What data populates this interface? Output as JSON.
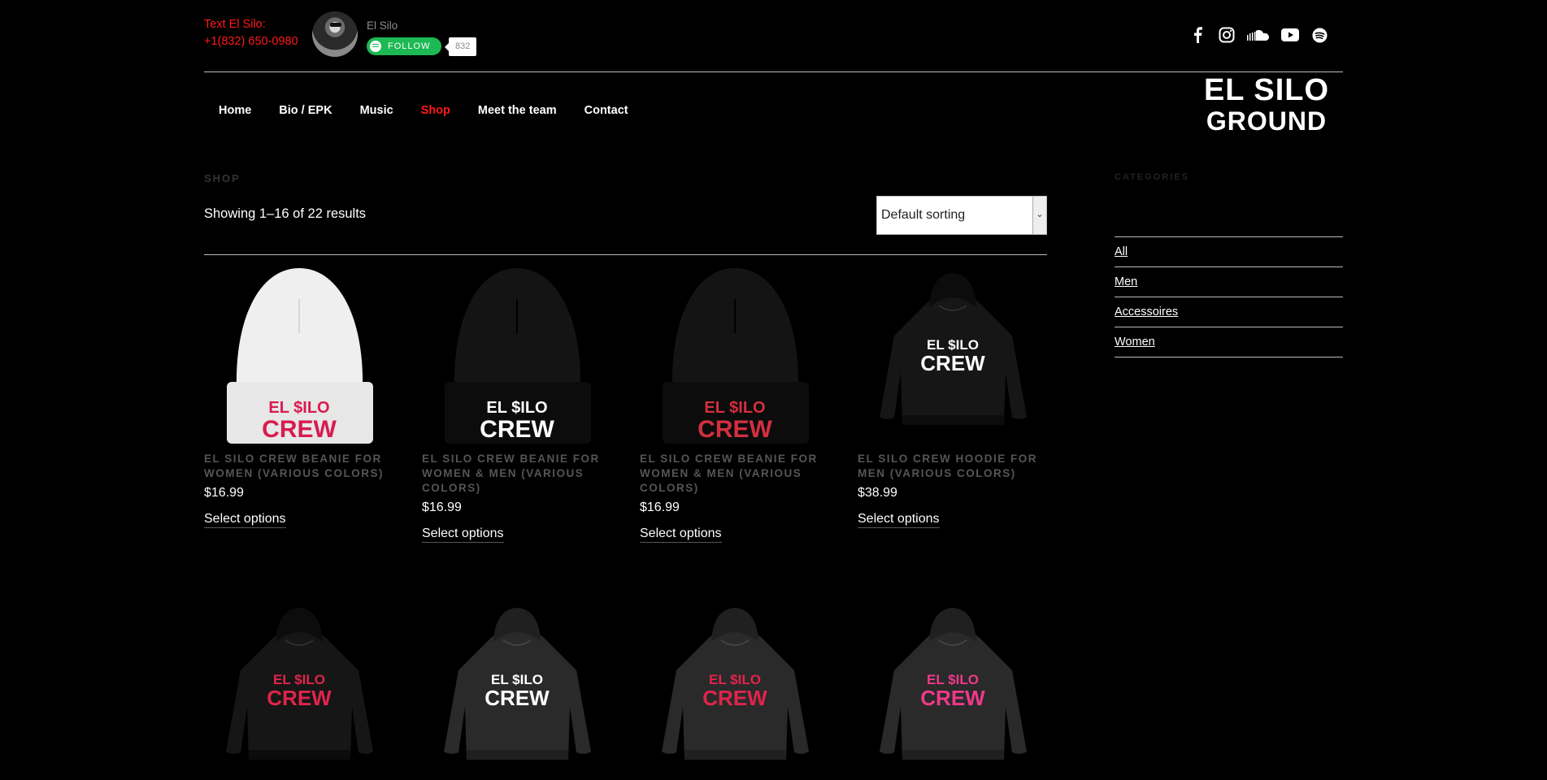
{
  "header": {
    "text_label": "Text El Silo:",
    "phone": "+1(832) 650-0980",
    "artist_name": "El Silo",
    "follow_label": "FOLLOW",
    "follower_count": "832",
    "social_icons": [
      "facebook-icon",
      "instagram-icon",
      "soundcloud-icon",
      "youtube-icon",
      "spotify-icon"
    ]
  },
  "nav": {
    "items": [
      "Home",
      "Bio / EPK",
      "Music",
      "Shop",
      "Meet the team",
      "Contact"
    ],
    "active": "Shop"
  },
  "logo": {
    "line1": "EL SILO",
    "line2": "GROUND"
  },
  "main": {
    "title": "SHOP",
    "result_count": "Showing 1–16 of 22 results",
    "sort_selected": "Default sorting"
  },
  "products": [
    {
      "title": "EL SILO CREW BEANIE FOR WOMEN (VARIOUS COLORS)",
      "price": "$16.99",
      "action": "Select options",
      "thumb": {
        "kind": "beanie",
        "color": "#efefef",
        "logo_color": "#d81b4f",
        "logo": [
          "EL $ILO",
          "CREW"
        ]
      }
    },
    {
      "title": "EL SILO CREW BEANIE FOR WOMEN & MEN (VARIOUS COLORS)",
      "price": "$16.99",
      "action": "Select options",
      "thumb": {
        "kind": "beanie",
        "color": "#141414",
        "logo_color": "#ffffff",
        "logo": [
          "EL $ILO",
          "CREW"
        ]
      }
    },
    {
      "title": "EL SILO CREW BEANIE FOR WOMEN & MEN (VARIOUS COLORS)",
      "price": "$16.99",
      "action": "Select options",
      "thumb": {
        "kind": "beanie",
        "color": "#141414",
        "logo_color": "#d32f3f",
        "logo": [
          "EL $ILO",
          "CREW"
        ]
      }
    },
    {
      "title": "EL SILO CREW HOODIE FOR MEN (VARIOUS COLORS)",
      "price": "$38.99",
      "action": "Select options",
      "thumb": {
        "kind": "hoodie",
        "color": "#161616",
        "logo_color": "#ffffff",
        "logo": [
          "EL $ILO",
          "CREW"
        ]
      }
    },
    {
      "thumb": {
        "kind": "hoodie",
        "color": "#161616",
        "logo_color": "#e0244c",
        "logo": [
          "EL $ILO",
          "CREW"
        ]
      }
    },
    {
      "thumb": {
        "kind": "hoodie",
        "color": "#2a2a2a",
        "logo_color": "#ffffff",
        "logo": [
          "EL $ILO",
          "CREW"
        ]
      }
    },
    {
      "thumb": {
        "kind": "hoodie",
        "color": "#2a2a2a",
        "logo_color": "#e0244c",
        "logo": [
          "EL $ILO",
          "CREW"
        ]
      }
    },
    {
      "thumb": {
        "kind": "hoodie",
        "color": "#2a2a2a",
        "logo_color": "#f0388a",
        "logo": [
          "EL $ILO",
          "CREW"
        ]
      }
    }
  ],
  "sidebar": {
    "title": "CATEGORIES",
    "categories": [
      "All",
      "Men",
      "Accessoires",
      "Women"
    ]
  },
  "colors": {
    "accent": "#ff1a1a",
    "spotify": "#1db954",
    "background": "#000000"
  }
}
